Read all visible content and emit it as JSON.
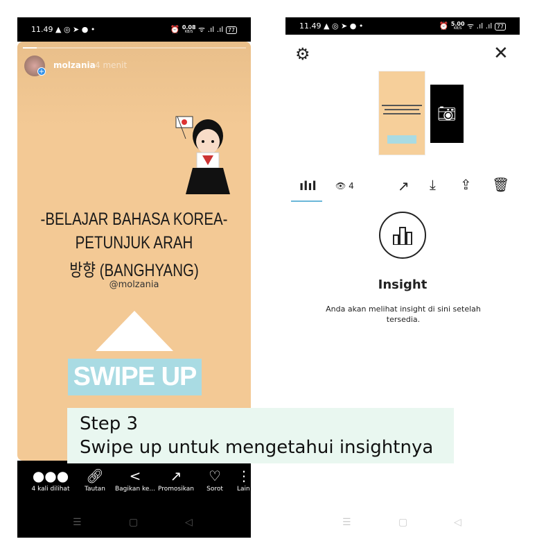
{
  "left": {
    "status": {
      "time": "11.49",
      "speed": "0.08",
      "speed_unit": "KB/S",
      "battery": "77"
    },
    "story": {
      "username": "molzania",
      "time_ago": "4 menit",
      "lines": [
        "-BELAJAR BAHASA KOREA-",
        "PETUNJUK ARAH",
        "방향 (BANGHYANG)"
      ],
      "handle": "@molzania",
      "swipe_label": "SWIPE UP"
    },
    "actions": [
      {
        "label": "4 kali dilihat",
        "icon": "viewers-avatars"
      },
      {
        "label": "Tautan",
        "icon": "link-icon"
      },
      {
        "label": "Bagikan ke...",
        "icon": "share-icon"
      },
      {
        "label": "Promosikan",
        "icon": "trend-icon"
      },
      {
        "label": "Sorot",
        "icon": "highlight-icon"
      },
      {
        "label": "Lain",
        "icon": "more-icon"
      }
    ]
  },
  "caption": {
    "line1": "Step 3",
    "line2": "Swipe up untuk mengetahui insightnya"
  },
  "right": {
    "status": {
      "time": "11.49",
      "speed": "5.00",
      "speed_unit": "KB/S",
      "battery": "77"
    },
    "views": "4",
    "insight_title": "Insight",
    "insight_text": "Anda akan melihat insight di sini setelah tersedia.",
    "accent": "#6ab7d8"
  }
}
